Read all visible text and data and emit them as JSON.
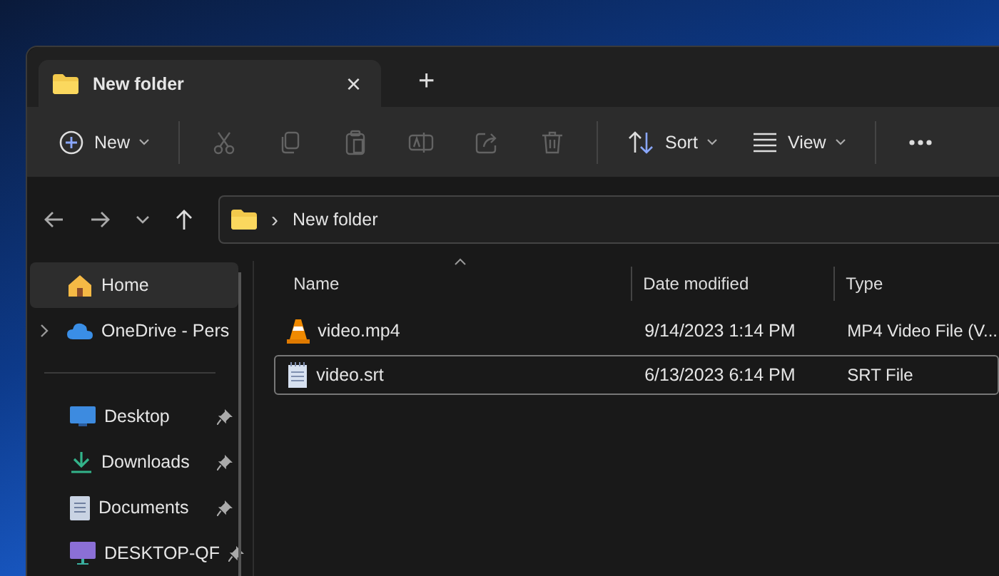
{
  "tab": {
    "title": "New folder",
    "close": "×",
    "new_tab": "+"
  },
  "toolbar": [
    {
      "kind": "new",
      "label": "New",
      "disabled": false
    },
    {
      "kind": "cut",
      "disabled": true
    },
    {
      "kind": "copy",
      "disabled": true
    },
    {
      "kind": "paste",
      "disabled": true
    },
    {
      "kind": "rename",
      "disabled": true
    },
    {
      "kind": "share",
      "disabled": true
    },
    {
      "kind": "delete",
      "disabled": true
    },
    {
      "kind": "sort",
      "label": "Sort",
      "disabled": false
    },
    {
      "kind": "view",
      "label": "View",
      "disabled": false
    },
    {
      "kind": "more",
      "disabled": false
    }
  ],
  "address": {
    "separator": "›",
    "path": "New folder"
  },
  "sidebar": {
    "items": [
      {
        "kind": "home",
        "label": "Home",
        "selected": true,
        "expandable": false
      },
      {
        "kind": "cloud",
        "label": "OneDrive - Pers",
        "selected": false,
        "expandable": true
      },
      {
        "kind": "desktop",
        "label": "Desktop",
        "selected": false,
        "expandable": false,
        "pinned": true
      },
      {
        "kind": "downloads",
        "label": "Downloads",
        "selected": false,
        "expandable": false,
        "pinned": true
      },
      {
        "kind": "documents",
        "label": "Documents",
        "selected": false,
        "expandable": false,
        "pinned": true
      },
      {
        "kind": "pc",
        "label": "DESKTOP-QF",
        "selected": false,
        "expandable": false,
        "pinned": true
      }
    ]
  },
  "table": {
    "columns": [
      "Name",
      "Date modified",
      "Type"
    ],
    "rows": [
      {
        "kind": "video",
        "name": "video.mp4",
        "date": "9/14/2023 1:14 PM",
        "type": "MP4 Video File (V...",
        "selected": false
      },
      {
        "kind": "text",
        "name": "video.srt",
        "date": "6/13/2023 6:14 PM",
        "type": "SRT File",
        "selected": true
      }
    ]
  }
}
